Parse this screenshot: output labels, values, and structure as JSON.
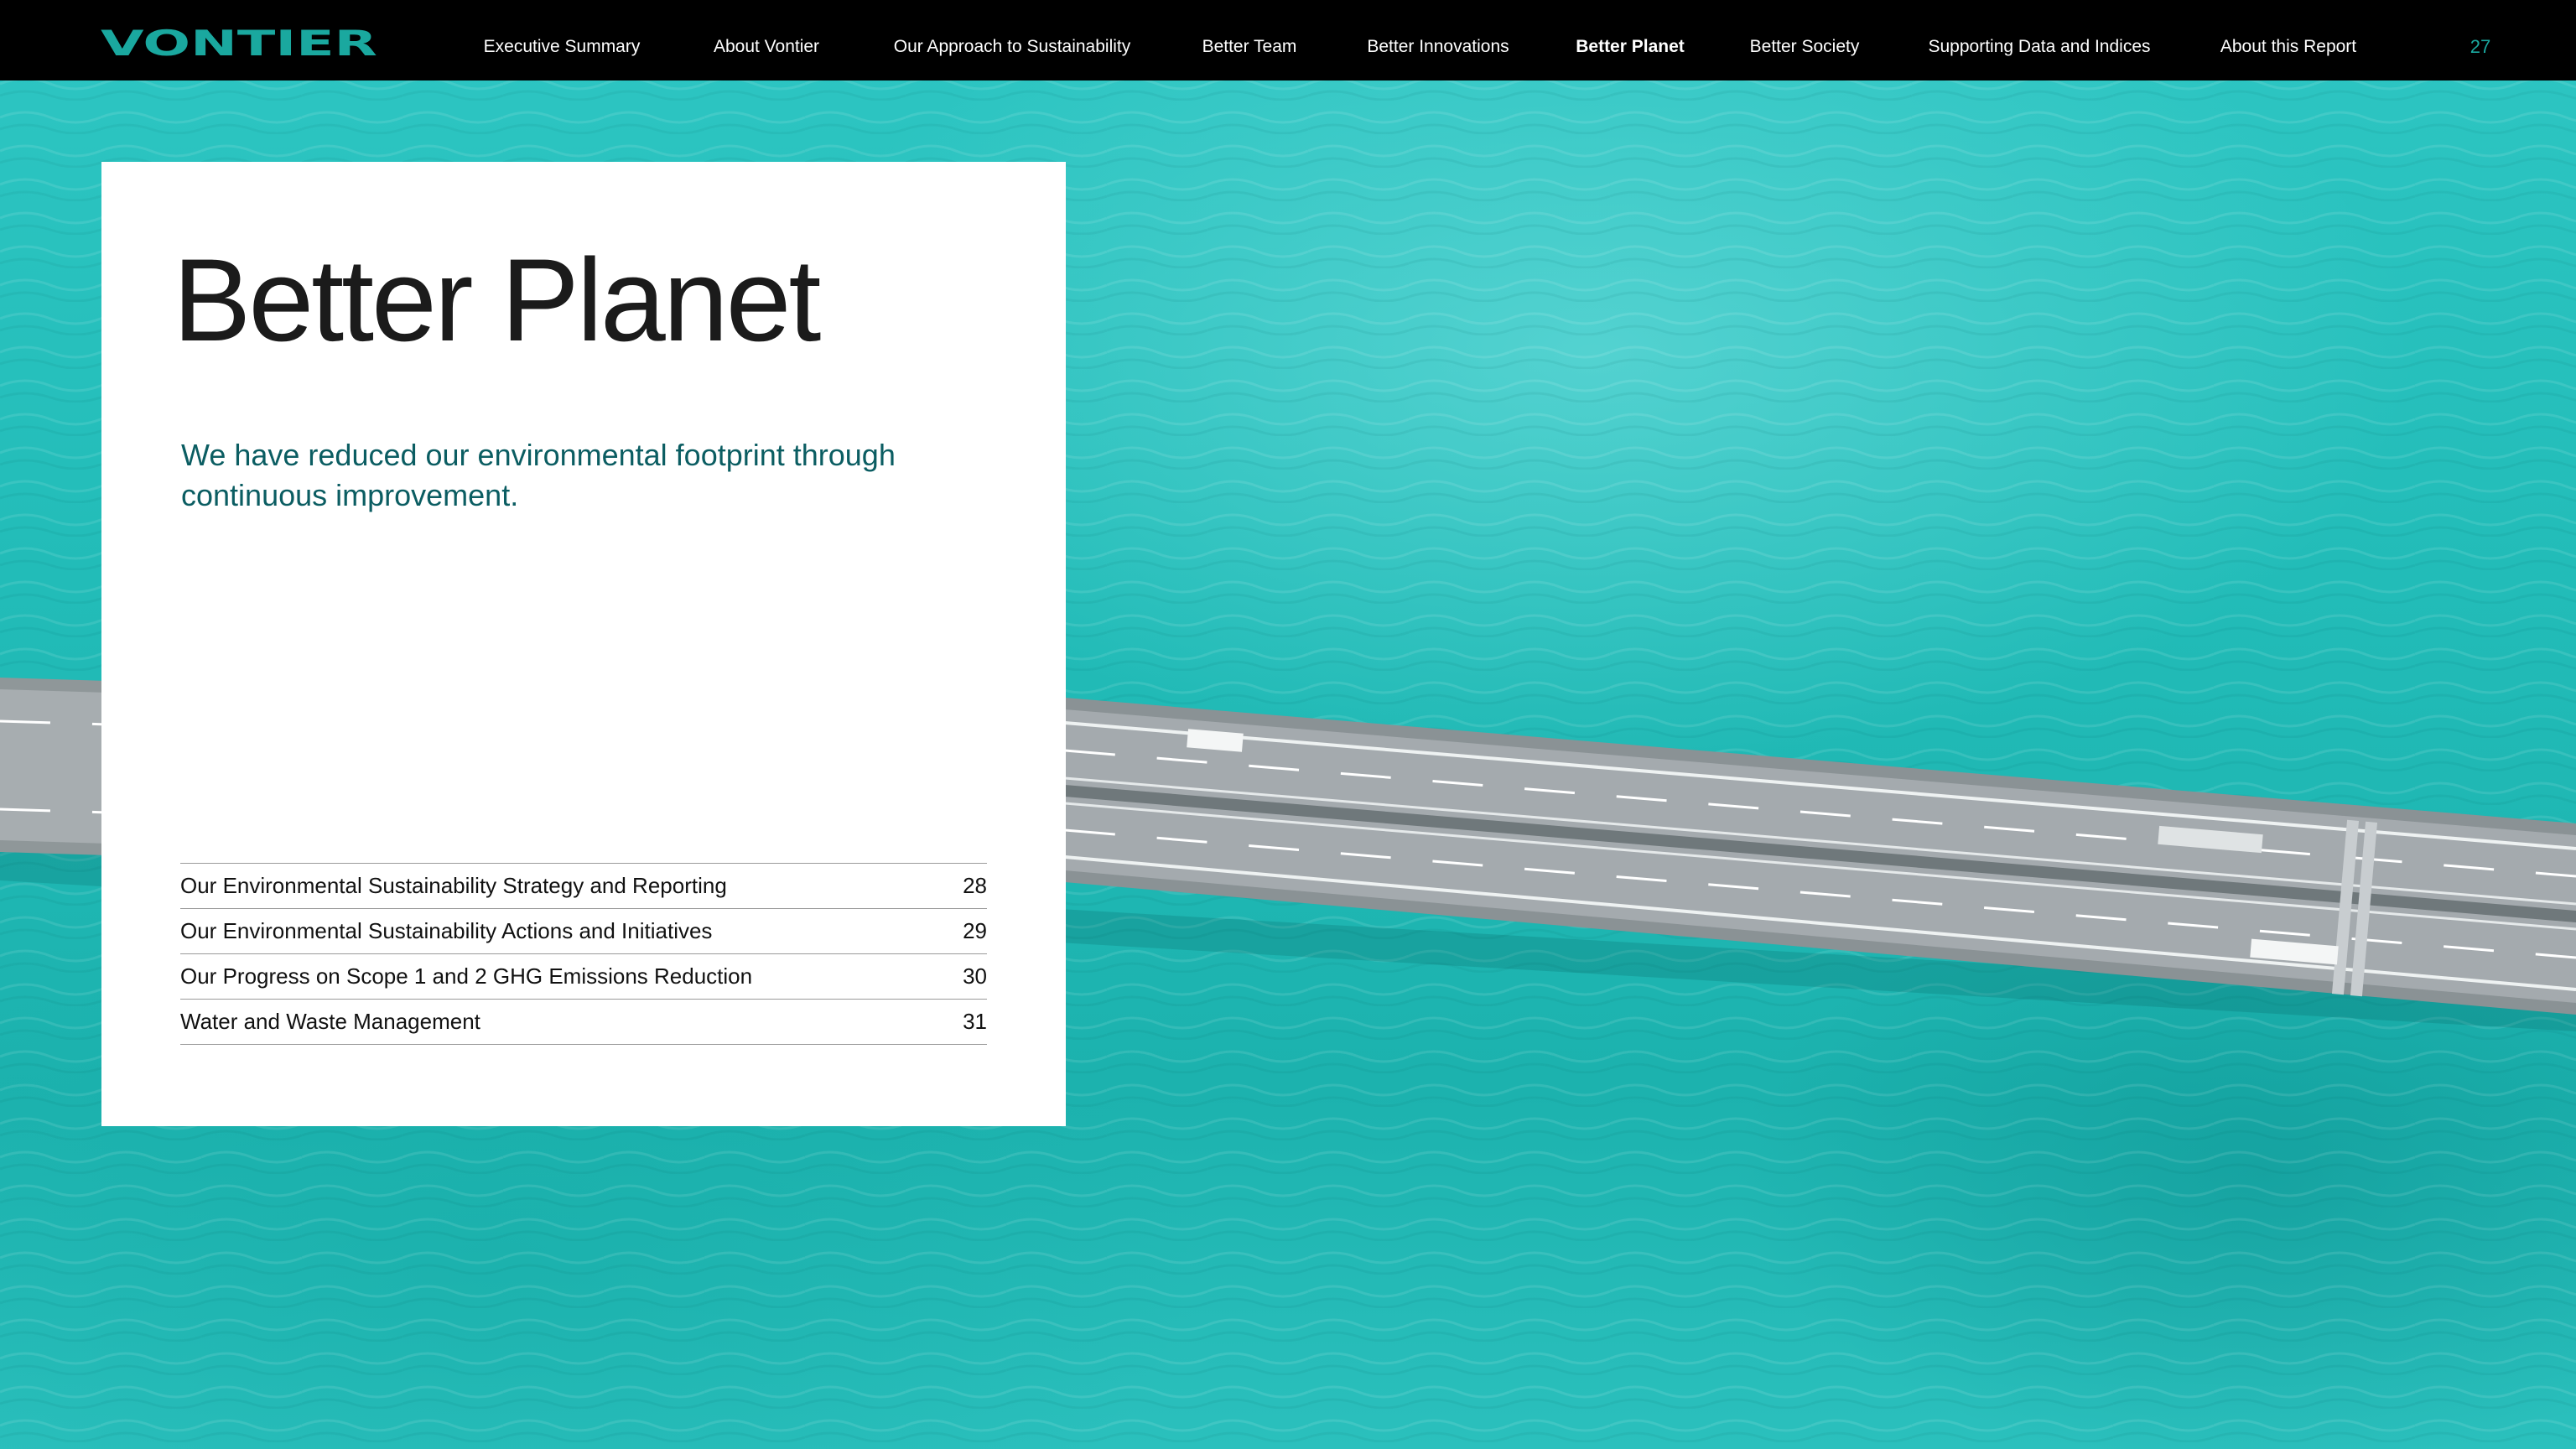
{
  "brand": {
    "name": "VONTIER",
    "color": "#1aa89f"
  },
  "nav": {
    "items": [
      {
        "label": "Executive Summary",
        "active": false
      },
      {
        "label": "About Vontier",
        "active": false
      },
      {
        "label": "Our Approach to Sustainability",
        "active": false
      },
      {
        "label": "Better Team",
        "active": false
      },
      {
        "label": "Better Innovations",
        "active": false
      },
      {
        "label": "Better Planet",
        "active": true
      },
      {
        "label": "Better Society",
        "active": false
      },
      {
        "label": "Supporting Data and Indices",
        "active": false
      },
      {
        "label": "About this Report",
        "active": false
      }
    ],
    "page_number": "27"
  },
  "card": {
    "title": "Better Planet",
    "intro": "We have reduced our environmental footprint through continuous improvement.",
    "toc": [
      {
        "label": "Our Environmental Sustainability Strategy and Reporting",
        "page": "28"
      },
      {
        "label": "Our Environmental Sustainability Actions and Initiatives",
        "page": "29"
      },
      {
        "label": "Our Progress on Scope 1 and 2 GHG Emissions Reduction",
        "page": "30"
      },
      {
        "label": "Water and Waste Management",
        "page": "31"
      }
    ]
  },
  "colors": {
    "nav_bg": "#000000",
    "water": "#22bcb8",
    "intro_text": "#0b5d62",
    "title_text": "#1b1b1b"
  },
  "icons": {
    "hero_image": "aerial-bridge-over-water-image"
  }
}
